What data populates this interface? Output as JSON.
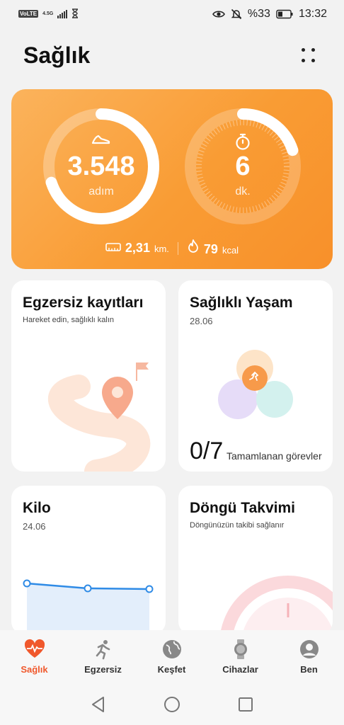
{
  "status_bar": {
    "volte": "VoLTE",
    "network": "4.5G",
    "battery": "%33",
    "time": "13:32"
  },
  "header": {
    "title": "Sağlık",
    "more_icon": "more-dots-icon"
  },
  "activity": {
    "steps_value": "3.548",
    "steps_unit": "adım",
    "steps_progress": 0.7,
    "minutes_value": "6",
    "minutes_unit": "dk.",
    "minutes_progress": 0.2,
    "distance_value": "2,31",
    "distance_unit": "km.",
    "calories_value": "79",
    "calories_unit": "kcal",
    "accent": "#f99c34"
  },
  "cards": {
    "exercise": {
      "title": "Egzersiz kayıtları",
      "subtitle": "Hareket edin, sağlıklı kalın"
    },
    "healthy_living": {
      "title": "Sağlıklı Yaşam",
      "date": "28.06",
      "count": "0/7",
      "label": "Tamamlanan görevler"
    },
    "weight": {
      "title": "Kilo",
      "date": "24.06"
    },
    "cycle": {
      "title": "Döngü Takvimi",
      "subtitle": "Döngünüzün takibi sağlanır"
    }
  },
  "bottom_nav": [
    {
      "label": "Sağlık",
      "icon": "heart-icon",
      "active": true
    },
    {
      "label": "Egzersiz",
      "icon": "running-icon",
      "active": false
    },
    {
      "label": "Keşfet",
      "icon": "globe-icon",
      "active": false
    },
    {
      "label": "Cihazlar",
      "icon": "watch-icon",
      "active": false
    },
    {
      "label": "Ben",
      "icon": "profile-icon",
      "active": false
    }
  ],
  "colors": {
    "active_nav": "#f0582c",
    "inactive_nav": "#888888"
  }
}
